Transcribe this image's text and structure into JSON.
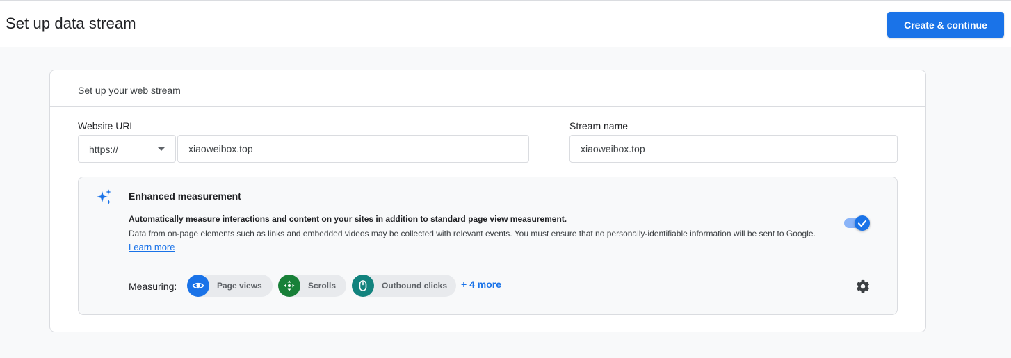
{
  "header": {
    "title": "Set up data stream",
    "create_button_label": "Create & continue"
  },
  "card": {
    "title": "Set up your web stream",
    "website_url": {
      "label": "Website URL",
      "protocol_selected": "https://",
      "value": "xiaoweibox.top"
    },
    "stream_name": {
      "label": "Stream name",
      "value": "xiaoweibox.top"
    }
  },
  "enhanced_measurement": {
    "title": "Enhanced measurement",
    "description_strong": "Automatically measure interactions and content on your sites in addition to standard page view measurement.",
    "description": "Data from on-page elements such as links and embedded videos may be collected with relevant events. You must ensure that no personally-identifiable information will be sent to Google.",
    "learn_more_label": "Learn more",
    "enabled": true,
    "measuring_label": "Measuring:",
    "chips": [
      {
        "label": "Page views",
        "icon": "eye-icon",
        "color": "#1a73e8"
      },
      {
        "label": "Scrolls",
        "icon": "scroll-arrows-icon",
        "color": "#188038"
      },
      {
        "label": "Outbound clicks",
        "icon": "mouse-icon",
        "color": "#12837e"
      }
    ],
    "more_label": "+ 4 more"
  },
  "colors": {
    "primary": "#1a73e8",
    "toggle_track": "#8ab4f8",
    "border": "#dadce0",
    "background": "#f8f9fa"
  }
}
